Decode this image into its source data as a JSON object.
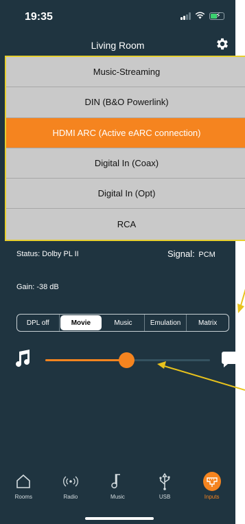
{
  "status_bar": {
    "time": "19:35"
  },
  "header": {
    "title": "Living Room"
  },
  "inputs": [
    {
      "label": "Music-Streaming",
      "active": false
    },
    {
      "label": "DIN (B&O Powerlink)",
      "active": false
    },
    {
      "label": "HDMI ARC (Active eARC connection)",
      "active": true
    },
    {
      "label": "Digital In (Coax)",
      "active": false
    },
    {
      "label": "Digital In (Opt)",
      "active": false
    },
    {
      "label": "RCA",
      "active": false
    }
  ],
  "status": {
    "text": "Status: Dolby PL II"
  },
  "signal": {
    "label": "Signal:",
    "value": "PCM"
  },
  "gain": {
    "text": "Gain: -38 dB"
  },
  "modes": {
    "selected": "Movie",
    "options": [
      "DPL off",
      "Movie",
      "Music",
      "Emulation",
      "Matrix"
    ]
  },
  "slider": {
    "value_fraction": 0.49
  },
  "tabs": [
    {
      "label": "Rooms",
      "icon": "home-icon"
    },
    {
      "label": "Radio",
      "icon": "radio-icon"
    },
    {
      "label": "Music",
      "icon": "music-note-icon"
    },
    {
      "label": "USB",
      "icon": "usb-icon"
    },
    {
      "label": "Inputs",
      "icon": "inputs-icon"
    }
  ],
  "colors": {
    "accent": "#f5841f",
    "background": "#1f3440",
    "highlight_border": "#e6cf2e",
    "annotation": "#e8c21c"
  }
}
